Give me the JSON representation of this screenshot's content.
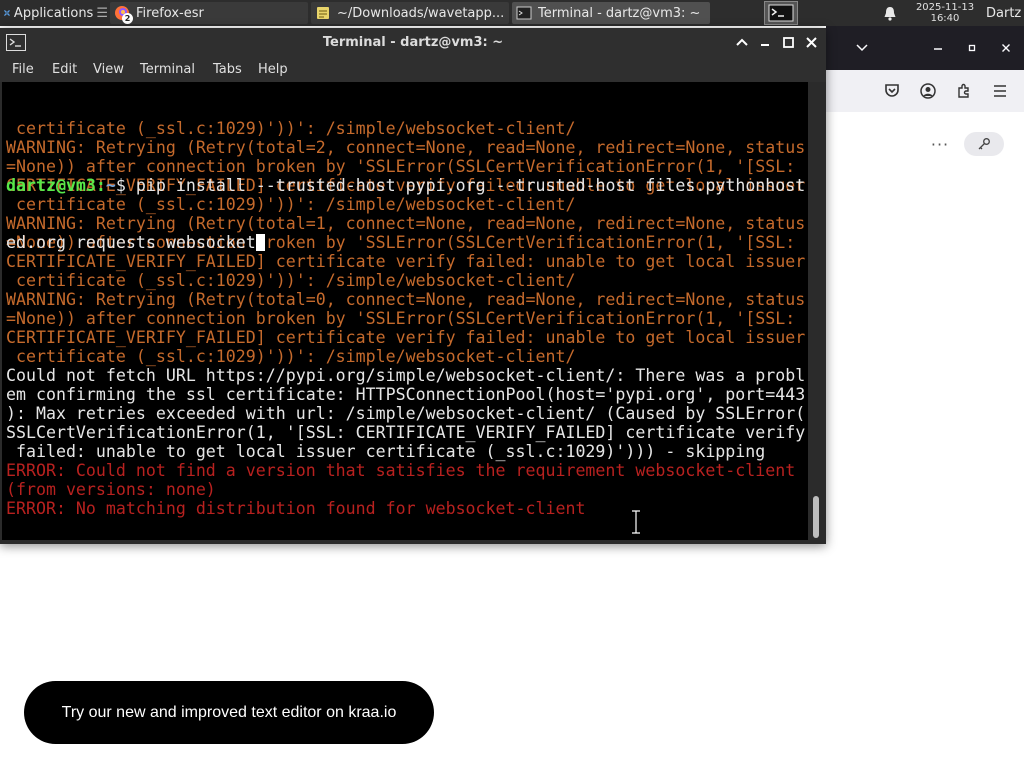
{
  "taskbar": {
    "applications_label": "Applications",
    "tasks": [
      {
        "label": "Firefox-esr",
        "icon": "firefox-icon",
        "badge": "2"
      },
      {
        "label": "~/Downloads/wavetapp...",
        "icon": "text-editor-icon"
      },
      {
        "label": "Terminal - dartz@vm3: ~",
        "icon": "terminal-icon"
      }
    ],
    "clock_date": "2025-11-13",
    "clock_time": "16:40",
    "user": "Dartz"
  },
  "terminal": {
    "title": "Terminal - dartz@vm3: ~",
    "menu": [
      "File",
      "Edit",
      "View",
      "Terminal",
      "Tabs",
      "Help"
    ],
    "lines": [
      {
        "text": " certificate (_ssl.c:1029)'))': /simple/websocket-client/",
        "style": "warn"
      },
      {
        "text": "WARNING: Retrying (Retry(total=2, connect=None, read=None, redirect=None, status",
        "style": "warn"
      },
      {
        "text": "=None)) after connection broken by 'SSLError(SSLCertVerificationError(1, '[SSL:",
        "style": "warn"
      },
      {
        "text": "CERTIFICATE_VERIFY_FAILED] certificate verify failed: unable to get local issuer",
        "style": "warn"
      },
      {
        "text": " certificate (_ssl.c:1029)'))': /simple/websocket-client/",
        "style": "warn"
      },
      {
        "text": "WARNING: Retrying (Retry(total=1, connect=None, read=None, redirect=None, status",
        "style": "warn"
      },
      {
        "text": "=None)) after connection broken by 'SSLError(SSLCertVerificationError(1, '[SSL:",
        "style": "warn"
      },
      {
        "text": "CERTIFICATE_VERIFY_FAILED] certificate verify failed: unable to get local issuer",
        "style": "warn"
      },
      {
        "text": " certificate (_ssl.c:1029)'))': /simple/websocket-client/",
        "style": "warn"
      },
      {
        "text": "WARNING: Retrying (Retry(total=0, connect=None, read=None, redirect=None, status",
        "style": "warn"
      },
      {
        "text": "=None)) after connection broken by 'SSLError(SSLCertVerificationError(1, '[SSL:",
        "style": "warn"
      },
      {
        "text": "CERTIFICATE_VERIFY_FAILED] certificate verify failed: unable to get local issuer",
        "style": "warn"
      },
      {
        "text": " certificate (_ssl.c:1029)'))': /simple/websocket-client/",
        "style": "warn"
      },
      {
        "text": "Could not fetch URL https://pypi.org/simple/websocket-client/: There was a probl",
        "style": "normal"
      },
      {
        "text": "em confirming the ssl certificate: HTTPSConnectionPool(host='pypi.org', port=443",
        "style": "normal"
      },
      {
        "text": "): Max retries exceeded with url: /simple/websocket-client/ (Caused by SSLError(",
        "style": "normal"
      },
      {
        "text": "SSLCertVerificationError(1, '[SSL: CERTIFICATE_VERIFY_FAILED] certificate verify",
        "style": "normal"
      },
      {
        "text": " failed: unable to get local issuer certificate (_ssl.c:1029)'))) - skipping",
        "style": "normal"
      },
      {
        "text": "ERROR: Could not find a version that satisfies the requirement websocket-client",
        "style": "err"
      },
      {
        "text": "(from versions: none)",
        "style": "err"
      },
      {
        "text": "ERROR: No matching distribution found for websocket-client",
        "style": "err"
      }
    ],
    "prompt_user": "dartz@vm3",
    "prompt_sep": ":",
    "prompt_path": "~",
    "prompt_symbol": "$ ",
    "command_line1": "pip install --trusted-host pypi.org --trusted-host files.pythonhost",
    "command_line2": "ed.org requests websocket"
  },
  "toast": {
    "text": "Try our new and improved text editor on kraa.io"
  },
  "colors": {
    "warning": "#c56a2c",
    "error": "#b8211f",
    "prompt_user": "#57e84a",
    "prompt_path": "#7aa6d8"
  }
}
